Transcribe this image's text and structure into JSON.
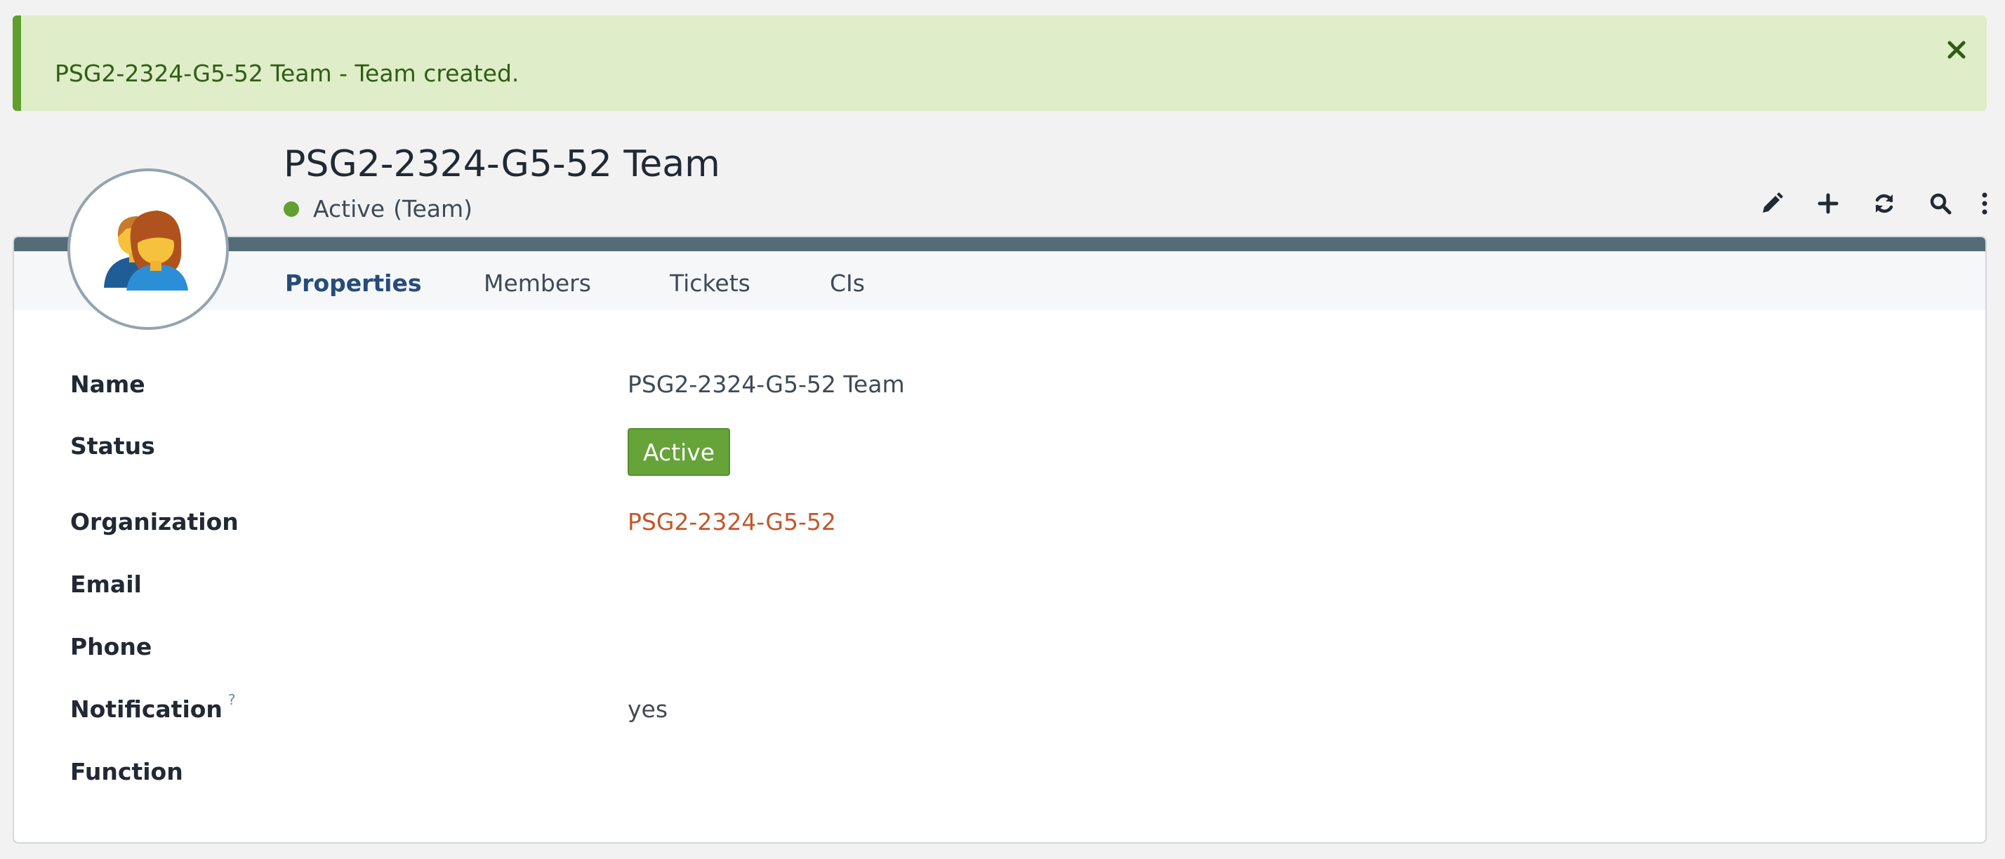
{
  "alert": {
    "message": "PSG2-2324-G5-52 Team - Team created.",
    "close_icon": "close-icon"
  },
  "header": {
    "title": "PSG2-2324-G5-52 Team",
    "status": "Active",
    "type": "(Team)",
    "status_color": "#62a032",
    "avatar_icon": "team-avatar-icon"
  },
  "toolbar": {
    "icons": [
      "edit-icon",
      "add-icon",
      "refresh-icon",
      "search-icon",
      "more-icon"
    ]
  },
  "tabs": [
    {
      "label": "Properties",
      "active": true
    },
    {
      "label": "Members",
      "active": false
    },
    {
      "label": "Tickets",
      "active": false
    },
    {
      "label": "CIs",
      "active": false
    }
  ],
  "properties": {
    "name": {
      "label": "Name",
      "value": "PSG2-2324-G5-52 Team"
    },
    "status": {
      "label": "Status",
      "value": "Active"
    },
    "organization": {
      "label": "Organization",
      "value": "PSG2-2324-G5-52"
    },
    "email": {
      "label": "Email",
      "value": ""
    },
    "phone": {
      "label": "Phone",
      "value": ""
    },
    "notification": {
      "label": "Notification",
      "help": "?",
      "value": "yes"
    },
    "function": {
      "label": "Function",
      "value": ""
    }
  },
  "colors": {
    "alert_bg": "#dfedc8",
    "alert_accent": "#5f9f2d",
    "active_badge": "#66a339",
    "link": "#c5562a",
    "active_tab": "#264c7a",
    "panel_bar": "#556b78"
  }
}
